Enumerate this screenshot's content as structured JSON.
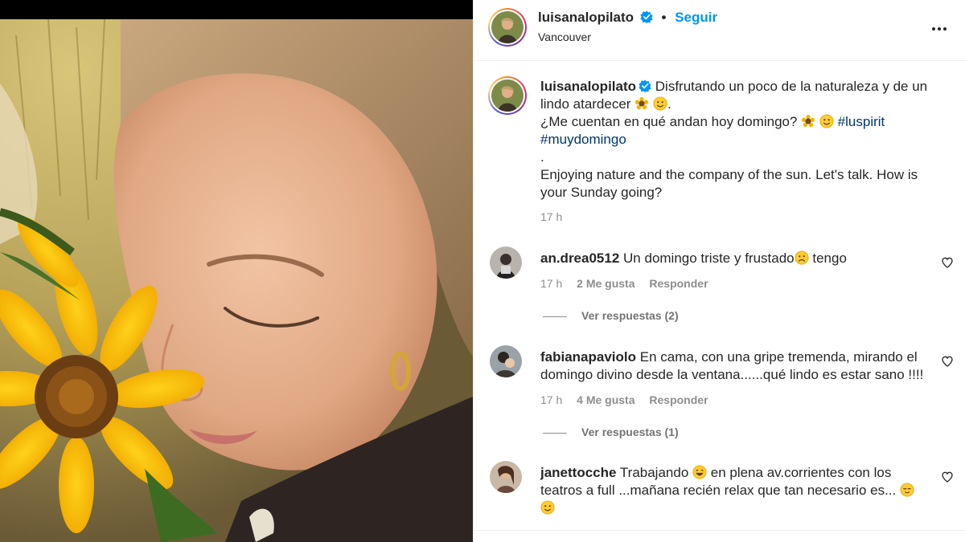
{
  "post": {
    "username": "luisanalopilato",
    "follow_label": "Seguir",
    "separator": "•",
    "location": "Vancouver",
    "caption_line1": "Disfrutando un poco de la naturaleza y de un lindo atardecer",
    "caption_line2": "¿Me cuentan en qué andan hoy domingo?",
    "hashtags": [
      "#luspirit",
      "#muydomingo"
    ],
    "caption_dot": ".",
    "caption_english": "Enjoying nature and the company of the sun. Let's talk. How is your Sunday going?",
    "time": "17 h"
  },
  "comments": [
    {
      "username": "an.drea0512",
      "text_before": "Un domingo triste y frustado",
      "emoji_mid": "worried",
      "text_after": " tengo",
      "time": "17 h",
      "likes": "2 Me gusta",
      "reply_label": "Responder",
      "view_replies": "Ver respuestas (2)"
    },
    {
      "username": "fabianapaviolo",
      "text_before": "En cama, con una gripe tremenda, mirando el domingo divino desde la ventana......qué lindo es estar sano !!!!",
      "time": "17 h",
      "likes": "4 Me gusta",
      "reply_label": "Responder",
      "view_replies": "Ver respuestas (1)"
    },
    {
      "username": "janettocche",
      "text_before": "Trabajando",
      "text_after": " en plena av.corrientes con los teatros a full ...mañana recién relax que tan necesario es...",
      "time": "",
      "likes": "",
      "reply_label": ""
    }
  ],
  "icons": [
    "verified-badge-icon",
    "more-options-icon",
    "heart-icon",
    "sunflower-emoji",
    "smile-emoji"
  ],
  "colors": {
    "follow": "#0095f6",
    "hashtag": "#00376b",
    "verified": "#0095f6",
    "muted": "#8e8e8e"
  }
}
